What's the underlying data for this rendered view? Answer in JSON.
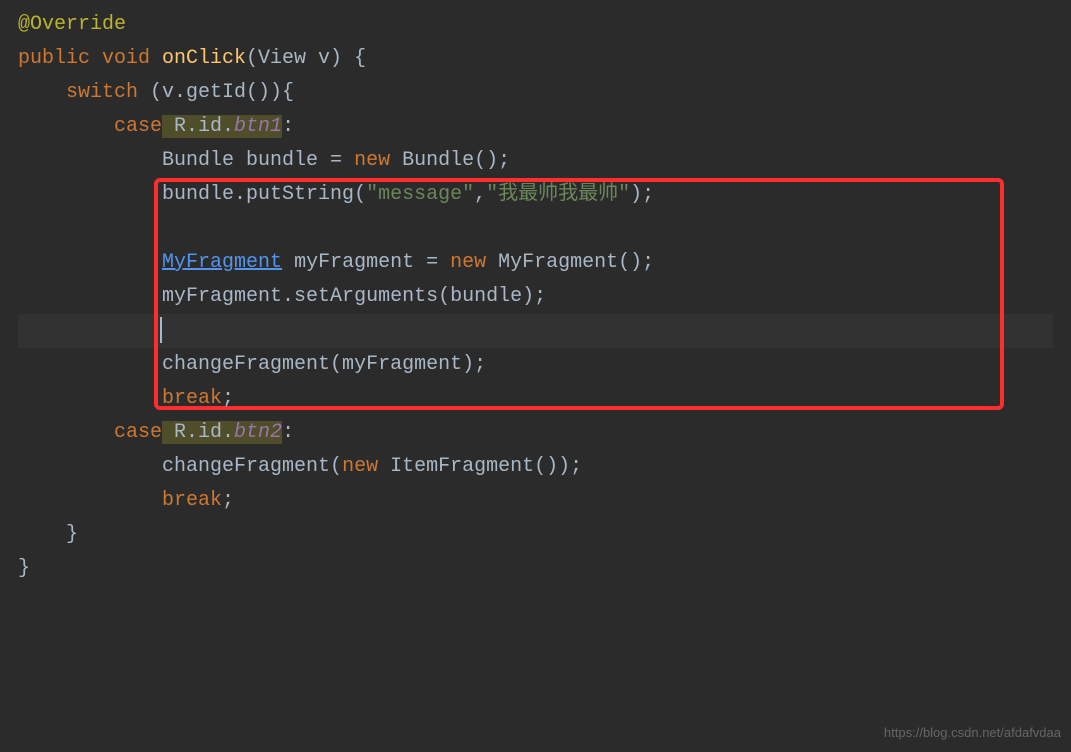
{
  "code": {
    "line1_annotation": "@Override",
    "line2_public": "public",
    "line2_void": " void ",
    "line2_method": "onClick",
    "line2_params": "(View v) {",
    "line3_switch": "switch",
    "line3_cond": " (v.getId()){",
    "line4_case": "case",
    "line4_rid": " R.id.",
    "line4_btn1": "btn1",
    "line4_colon": ":",
    "line5_bundle": "Bundle bundle = ",
    "line5_new": "new",
    "line5_ctor": " Bundle();",
    "line6_put1": "bundle.putString(",
    "line6_str1": "\"message\"",
    "line6_comma": ",",
    "line6_str2": "\"我最帅我最帅\"",
    "line6_end": ");",
    "line8_frag": "MyFragment",
    "line8_var": " myFragment = ",
    "line8_new": "new",
    "line8_ctor": " MyFragment();",
    "line9_setargs": "myFragment.setArguments(bundle);",
    "line11_change": "changeFragment(myFragment);",
    "line12_break": "break",
    "line12_semi": ";",
    "line13_case": "case",
    "line13_rid": " R.id.",
    "line13_btn2": "btn2",
    "line13_colon": ":",
    "line14_change": "changeFragment(",
    "line14_new": "new",
    "line14_ctor": " ItemFragment());",
    "line15_break": "break",
    "line15_semi": ";",
    "line16_brace": "}",
    "line17_brace": "}"
  },
  "watermark": "https://blog.csdn.net/afdafvdaa"
}
